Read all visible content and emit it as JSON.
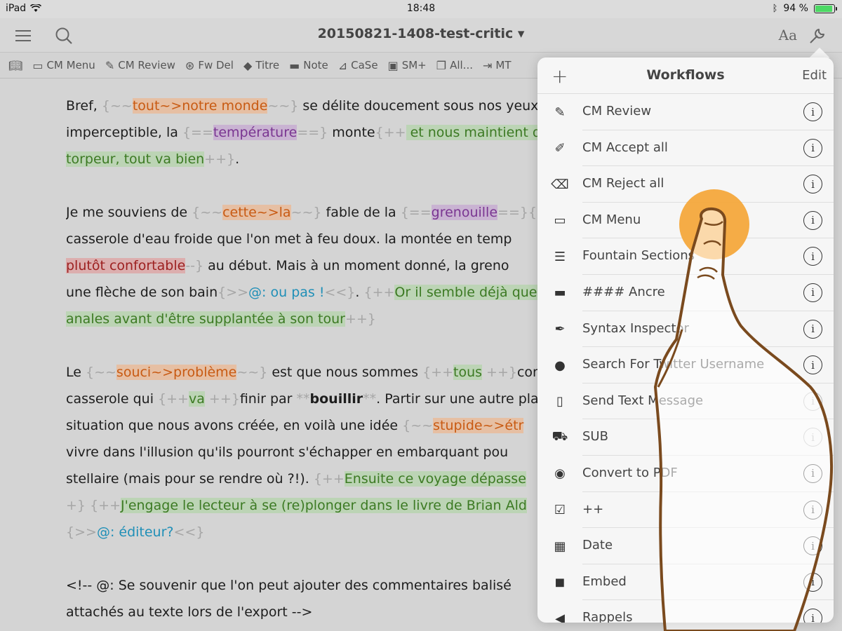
{
  "status": {
    "device": "iPad",
    "time": "18:48",
    "battery": "94 %",
    "battery_level": 0.94
  },
  "nav": {
    "title": "20150821-1408-test-critic ▾",
    "font_button": "Aa"
  },
  "toolbar": {
    "items": [
      {
        "label": "",
        "icon": "book-icon"
      },
      {
        "label": "CM Menu",
        "icon": "comment-icon"
      },
      {
        "label": "CM Review",
        "icon": "pencil-icon"
      },
      {
        "label": "Fw Del",
        "icon": "forward-delete-icon"
      },
      {
        "label": "Titre",
        "icon": "tag-icon"
      },
      {
        "label": "Note",
        "icon": "speech-bubble-icon"
      },
      {
        "label": "CaSe",
        "icon": "chart-icon"
      },
      {
        "label": "SM+",
        "icon": "disk-icon"
      },
      {
        "label": "All...",
        "icon": "copy-icon"
      },
      {
        "label": "MT",
        "icon": "export-icon"
      }
    ]
  },
  "editor": {
    "p1": {
      "a": "Bref, ",
      "m1": "{~~",
      "s1": "tout~>notre monde",
      "m2": "~~}",
      "b": " se délite doucement sous nos yeux",
      "c": "imperceptible, la ",
      "m3": "{==",
      "h1": "température",
      "m4": "==}",
      "d": " monte",
      "m5": "{++",
      "a1": " et nous maintient d",
      "a2": "torpeur, tout va bien",
      "m6": "++}",
      "e": "."
    },
    "p2": {
      "a": "Je me souviens de ",
      "m1": "{~~",
      "s1": "cette~>la",
      "m2": "~~}",
      "b": " fable de la ",
      "m3": "{==",
      "h1": "grenouille",
      "m4": "==}",
      "m5": "{>>@",
      "c": "casserole d'eau froide que l'on met à feu doux. la montée en temp",
      "d1": "plutôt confortable",
      "m6": "--}",
      "d": " au début. Mais à un moment donné, la greno",
      "e": "une flèche de son bain",
      "m7": "{>>",
      "c1": "@: ou pas !",
      "m8": "<<}",
      "f": ". ",
      "m9": "{++",
      "a1": "Or il semble déjà que l",
      "a2": "anales avant d'être supplantée à son tour",
      "m10": "++}"
    },
    "p3": {
      "a": "Le ",
      "m1": "{~~",
      "s1": "souci~>problème",
      "m2": "~~}",
      "b": " est que nous sommes ",
      "m3": "{++",
      "a1": "tous",
      "m4": " ++}",
      "c": "conda",
      "d": "casserole qui ",
      "m5": "{++",
      "a2": "va",
      "m6": " ++}",
      "e": "finir par ",
      "m7": "**",
      "bold": "bouillir",
      "m8": "**",
      "f": ". Partir sur une autre pla",
      "g": "situation que nous avons créée, en voilà une idée ",
      "m9": "{~~",
      "s2": "stupide~>étr",
      "h": "vivre dans l'illusion qu'ils pourront s'échapper en embarquant pou",
      "i": "stellaire (mais pour se rendre où ?!). ",
      "m10": "{++",
      "a3": "Ensuite ce voyage dépasse",
      "m11": "+}",
      "j": " ",
      "m12": "{++",
      "a4": "J'engage le lecteur à se (re)plonger dans le livre de Brian Ald",
      "m13": "{>>",
      "c1": "@: éditeur?",
      "m14": "<<}"
    },
    "p4": {
      "line1": "<!-- @: Se souvenir que l'on peut ajouter des commentaires balisé",
      "line2": "attachés au texte lors de l'export -->"
    }
  },
  "workflows": {
    "title": "Workflows",
    "edit_label": "Edit",
    "items": [
      {
        "label": "CM Review",
        "icon": "pencil-icon",
        "dim": false
      },
      {
        "label": "CM Accept all",
        "icon": "pen-line-icon",
        "dim": false
      },
      {
        "label": "CM Reject all",
        "icon": "eraser-icon",
        "dim": false
      },
      {
        "label": "CM Menu",
        "icon": "comment-icon",
        "dim": false
      },
      {
        "label": "Fountain Sections",
        "icon": "list-icon",
        "dim": false
      },
      {
        "label": "#### Ancre",
        "icon": "dash-icon",
        "dim": false
      },
      {
        "label": "Syntax Inspector",
        "icon": "brush-icon",
        "dim": false
      },
      {
        "label": "Search For Twitter Username",
        "icon": "person-icon",
        "dim": false
      },
      {
        "label": "Send Text Message",
        "icon": "phone-icon",
        "dim": true
      },
      {
        "label": "SUB",
        "icon": "cart-icon",
        "dim": true
      },
      {
        "label": "Convert to PDF",
        "icon": "document-eye-icon",
        "dim": false
      },
      {
        "label": "++",
        "icon": "checkbox-icon",
        "dim": false
      },
      {
        "label": "Date",
        "icon": "calendar-icon",
        "dim": false
      },
      {
        "label": "Embed",
        "icon": "cube-icon",
        "dim": false
      },
      {
        "label": "Rappels",
        "icon": "megaphone-icon",
        "dim": false
      }
    ]
  },
  "colors": {
    "substitution": "#c85a12",
    "highlight": "#7a3591",
    "addition": "#3c7a23",
    "deletion": "#9c1f1f",
    "comment": "#1f8fb7",
    "touch": "#f4a83c",
    "finger_outline": "#7a4a1e"
  }
}
